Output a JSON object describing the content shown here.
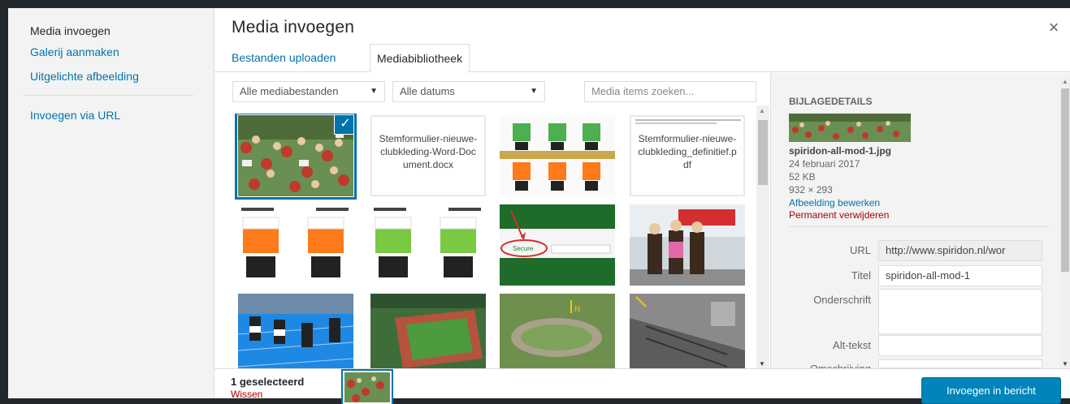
{
  "menu": {
    "items": [
      {
        "label": "Media invoegen"
      },
      {
        "label": "Galerij aanmaken"
      },
      {
        "label": "Uitgelichte afbeelding"
      },
      {
        "label": "Invoegen via URL"
      }
    ]
  },
  "modal": {
    "title": "Media invoegen",
    "close": "×"
  },
  "tabs": [
    "Bestanden uploaden",
    "Mediabibliotheek"
  ],
  "filters": {
    "type": "Alle mediabestanden",
    "date": "Alle datums",
    "search_placeholder": "Media items zoeken..."
  },
  "grid": {
    "docx_name": "Stemformulier-nieuwe-clubkleding-Word-Document.docx",
    "pdf_name": "Stemformulier-nieuwe-clubkleding_definitief.pdf",
    "check": "✓",
    "secure_text": "Secure"
  },
  "details": {
    "heading": "BIJLAGEDETAILS",
    "filename": "spiridon-all-mod-1.jpg",
    "date": "24 februari 2017",
    "size": "52 KB",
    "dimensions": "932 × 293",
    "edit_link": "Afbeelding bewerken",
    "delete_link": "Permanent verwijderen",
    "fields": {
      "url_label": "URL",
      "url_value": "http://www.spiridon.nl/wor",
      "title_label": "Titel",
      "title_value": "spiridon-all-mod-1",
      "caption_label": "Onderschrift",
      "alt_label": "Alt-tekst",
      "desc_label": "Omschrijving"
    }
  },
  "toolbar": {
    "selected_count": "1 geselecteerd",
    "clear": "Wissen",
    "insert_button": "Invoegen in bericht"
  },
  "colors": {
    "accent": "#0073aa",
    "button": "#0085ba",
    "danger": "#a00",
    "sidebar_bg": "#f3f3f3"
  }
}
